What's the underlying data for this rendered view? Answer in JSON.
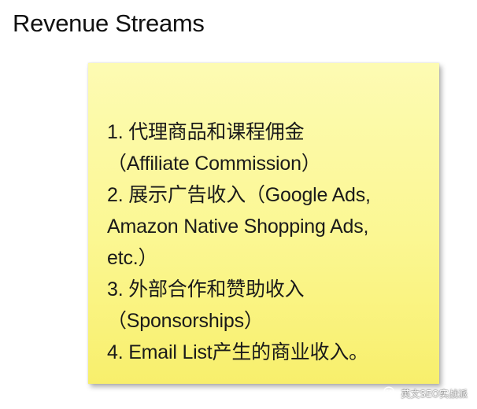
{
  "slide": {
    "title": "Revenue Streams"
  },
  "note": {
    "lines": [
      "1. 代理商品和课程佣金",
      "（Affiliate Commission）",
      "2. 展示广告收入（Google Ads,",
      "Amazon Native Shopping Ads,",
      "etc.）",
      "3. 外部合作和赞助收入",
      "（Sponsorships）",
      "4. Email List产生的商业收入。"
    ],
    "colors": {
      "top": "#fdfbb3",
      "bottom": "#f8ef6c"
    }
  },
  "watermark": {
    "icon": "wechat-icon",
    "text": "英文SEO实战派"
  }
}
